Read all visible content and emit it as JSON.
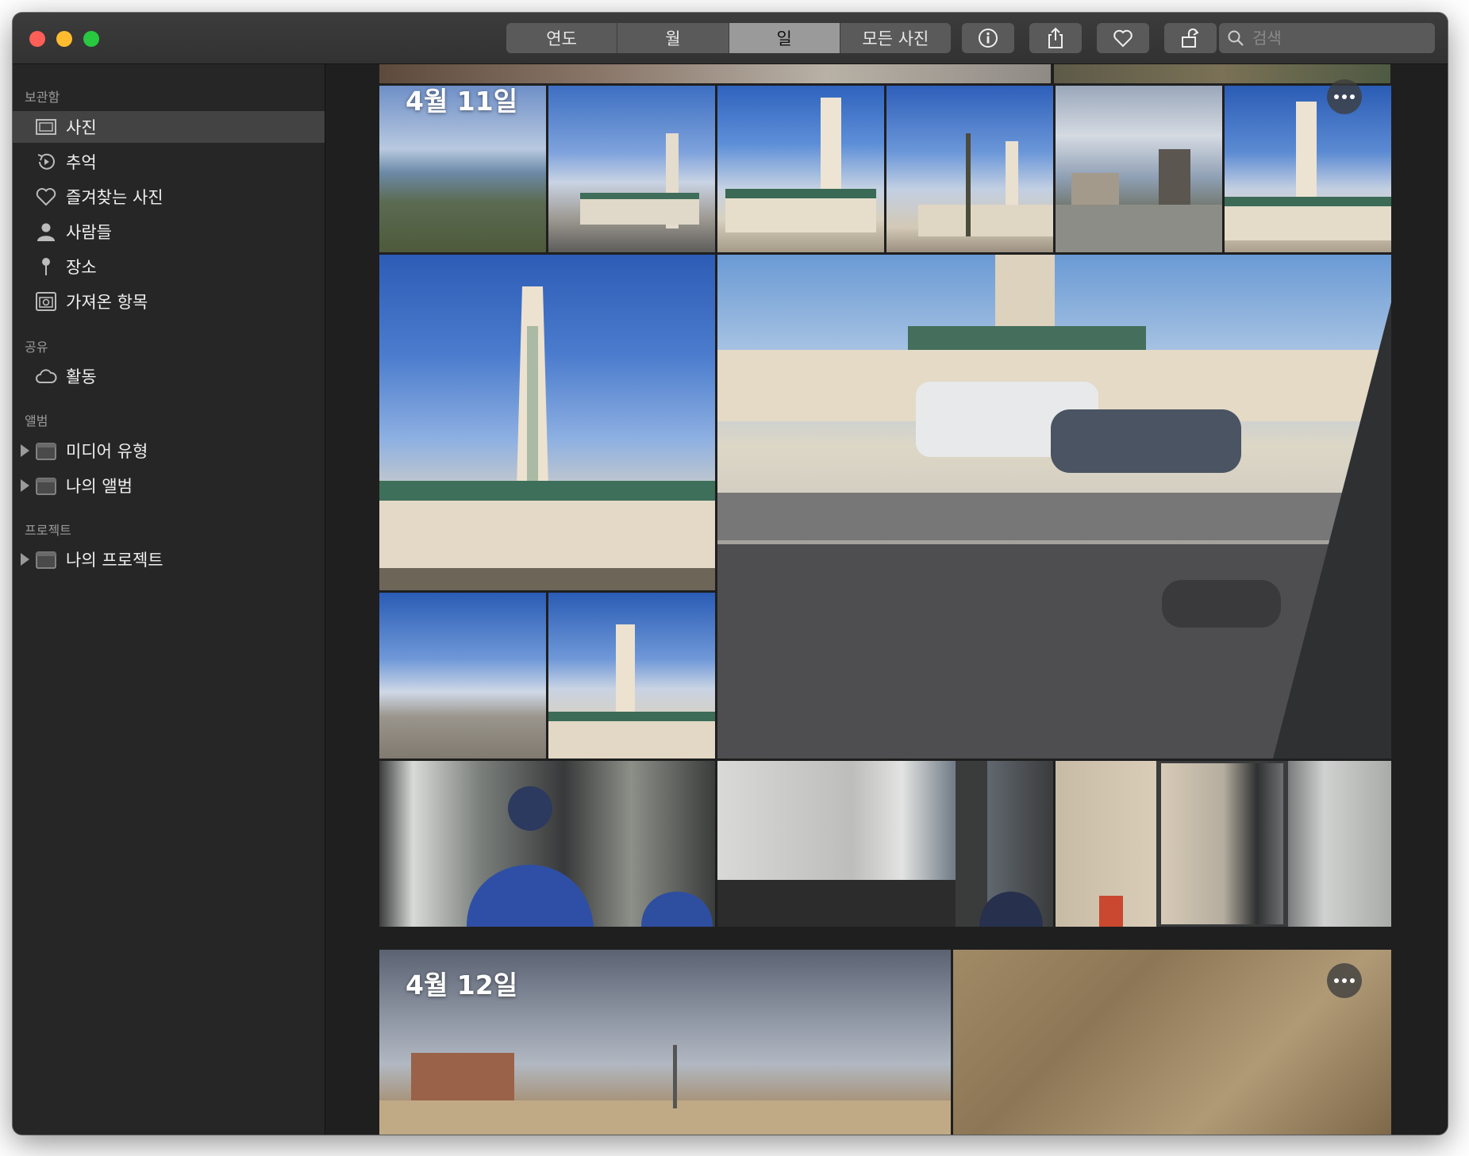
{
  "toolbar": {
    "view_tabs": [
      {
        "label": "연도"
      },
      {
        "label": "월"
      },
      {
        "label": "일",
        "active": true
      },
      {
        "label": "모든 사진"
      }
    ],
    "search_placeholder": "검색",
    "buttons": [
      "info-icon",
      "share-icon",
      "heart-icon",
      "rotate-icon"
    ]
  },
  "sidebar": {
    "sections": {
      "library": "보관함",
      "shared": "공유",
      "albums": "앨범",
      "projects": "프로젝트"
    },
    "library_items": [
      {
        "label": "사진",
        "icon": "photos-icon",
        "selected": true
      },
      {
        "label": "추억",
        "icon": "memories-icon"
      },
      {
        "label": "즐겨찾는 사진",
        "icon": "heart-icon"
      },
      {
        "label": "사람들",
        "icon": "person-icon"
      },
      {
        "label": "장소",
        "icon": "pin-icon"
      },
      {
        "label": "가져온 항목",
        "icon": "camera-icon"
      }
    ],
    "shared_items": [
      {
        "label": "활동",
        "icon": "cloud-icon"
      }
    ],
    "album_items": [
      {
        "label": "미디어 유형",
        "icon": "folder-icon"
      },
      {
        "label": "나의 앨범",
        "icon": "folder-icon"
      }
    ],
    "project_items": [
      {
        "label": "나의 프로젝트",
        "icon": "folder-icon"
      }
    ]
  },
  "content": {
    "day_groups": [
      {
        "date": "4월 11일"
      },
      {
        "date": "4월 12일"
      }
    ]
  },
  "colors": {
    "titlebar": "#363636",
    "sidebar": "#262626",
    "content_bg": "#1f1f1f",
    "selected_row": "#434343",
    "segment_active": "#9a9a9a"
  }
}
